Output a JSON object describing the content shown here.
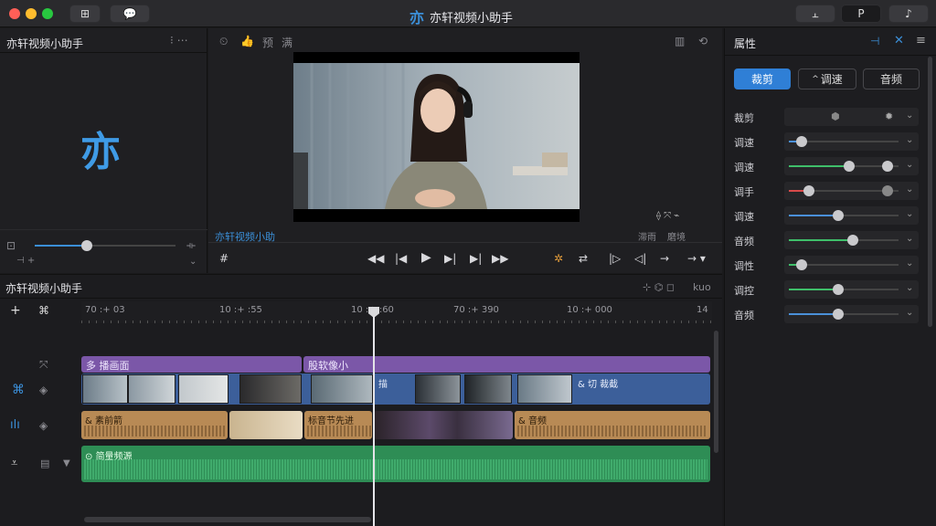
{
  "window": {
    "title": "亦轩视频小助手",
    "logo_glyph": "亦"
  },
  "toolbar": {
    "right_tabs": [
      "⫠",
      "P",
      "♪"
    ]
  },
  "media_panel": {
    "title": "亦轩视频小助手",
    "logo_text": "亦"
  },
  "preview": {
    "header_labels": [
      "预",
      "满"
    ],
    "caption": "亦轩视频小助",
    "right_labels": [
      "滞雨",
      "磨境"
    ]
  },
  "inspector": {
    "title": "属性",
    "tabs": [
      "裁剪",
      "调速",
      "音频"
    ],
    "active_tab": "裁剪",
    "rows": [
      {
        "label": "裁剪",
        "value": 0.5,
        "color": "#4a90d9"
      },
      {
        "label": "调速",
        "value": 0.12,
        "color": "#4a90d9"
      },
      {
        "label": "调速",
        "value": 0.55,
        "color": "#3fbf6a"
      },
      {
        "label": "调手",
        "value": 0.18,
        "color": "#d94a4a"
      },
      {
        "label": "调速",
        "value": 0.45,
        "color": "#4a90d9"
      },
      {
        "label": "音频",
        "value": 0.58,
        "color": "#3fbf6a"
      },
      {
        "label": "调性",
        "value": 0.12,
        "color": "#3fbf6a"
      },
      {
        "label": "调控",
        "value": 0.45,
        "color": "#3fbf6a"
      },
      {
        "label": "音频",
        "value": 0.45,
        "color": "#4a90d9"
      }
    ]
  },
  "timeline": {
    "title": "亦轩视频小助手",
    "timecodes": [
      "70 :+ 03",
      "10 :+ :55",
      "10 :+ :60",
      "70 :+ 390",
      "10 :+ 000",
      "14"
    ],
    "zoom_label": "kuo",
    "purple_clips": [
      "多 播画面",
      "股软像小"
    ],
    "blue_clip_labels": [
      "描",
      "& 切 裁截"
    ],
    "orange_clips": [
      "& 素前箭",
      "标音节先进",
      "& 音频"
    ],
    "green_clip": "简量频源"
  },
  "colors": {
    "accent": "#2f7fd6",
    "clip_purple": "#7b57a8",
    "clip_blue": "#3c5f9a",
    "clip_orange": "#b88a55",
    "clip_green": "#2e8d55"
  }
}
